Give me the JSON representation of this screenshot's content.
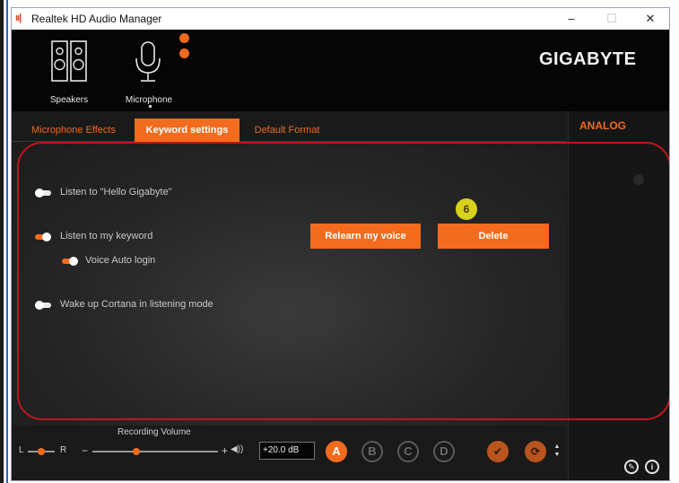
{
  "window": {
    "app_icon": "sound-icon",
    "title": "Realtek HD Audio Manager",
    "controls": {
      "minimize": "–",
      "maximize": "☐",
      "close": "✕"
    }
  },
  "header": {
    "devices": [
      {
        "label": "Speakers",
        "icon": "speakers-icon"
      },
      {
        "label": "Microphone",
        "icon": "microphone-icon"
      }
    ],
    "brand": "GIGABYTE"
  },
  "tabs": [
    {
      "label": "Microphone Effects",
      "active": false
    },
    {
      "label": "Keyword settings",
      "active": true
    },
    {
      "label": "Default Format",
      "active": false
    }
  ],
  "side_panel": {
    "label": "ANALOG"
  },
  "keyword_settings": {
    "options": [
      {
        "label": "Listen to \"Hello Gigabyte\"",
        "enabled": false
      },
      {
        "label": "Listen to my keyword",
        "enabled": true
      },
      {
        "label": "Voice Auto login",
        "enabled": true
      },
      {
        "label": "Wake up Cortana in listening mode",
        "enabled": false
      }
    ],
    "relearn_button": "Relearn my voice",
    "delete_button": "Delete",
    "callout": "6"
  },
  "recording": {
    "label": "Recording Volume",
    "balance_left": "L",
    "balance_right": "R",
    "minus": "−",
    "plus": "+",
    "speaker_icon": "speaker-icon",
    "level_db": "+20.0 dB",
    "volume_fraction": 0.35,
    "balance_fraction": 0.5,
    "presets": [
      "A",
      "B",
      "C",
      "D"
    ],
    "active_preset": "A"
  },
  "colors": {
    "accent": "#f36b1c",
    "background": "#1b1b1b",
    "highlight_outline": "#c3141c",
    "callout": "#d8d21a"
  }
}
